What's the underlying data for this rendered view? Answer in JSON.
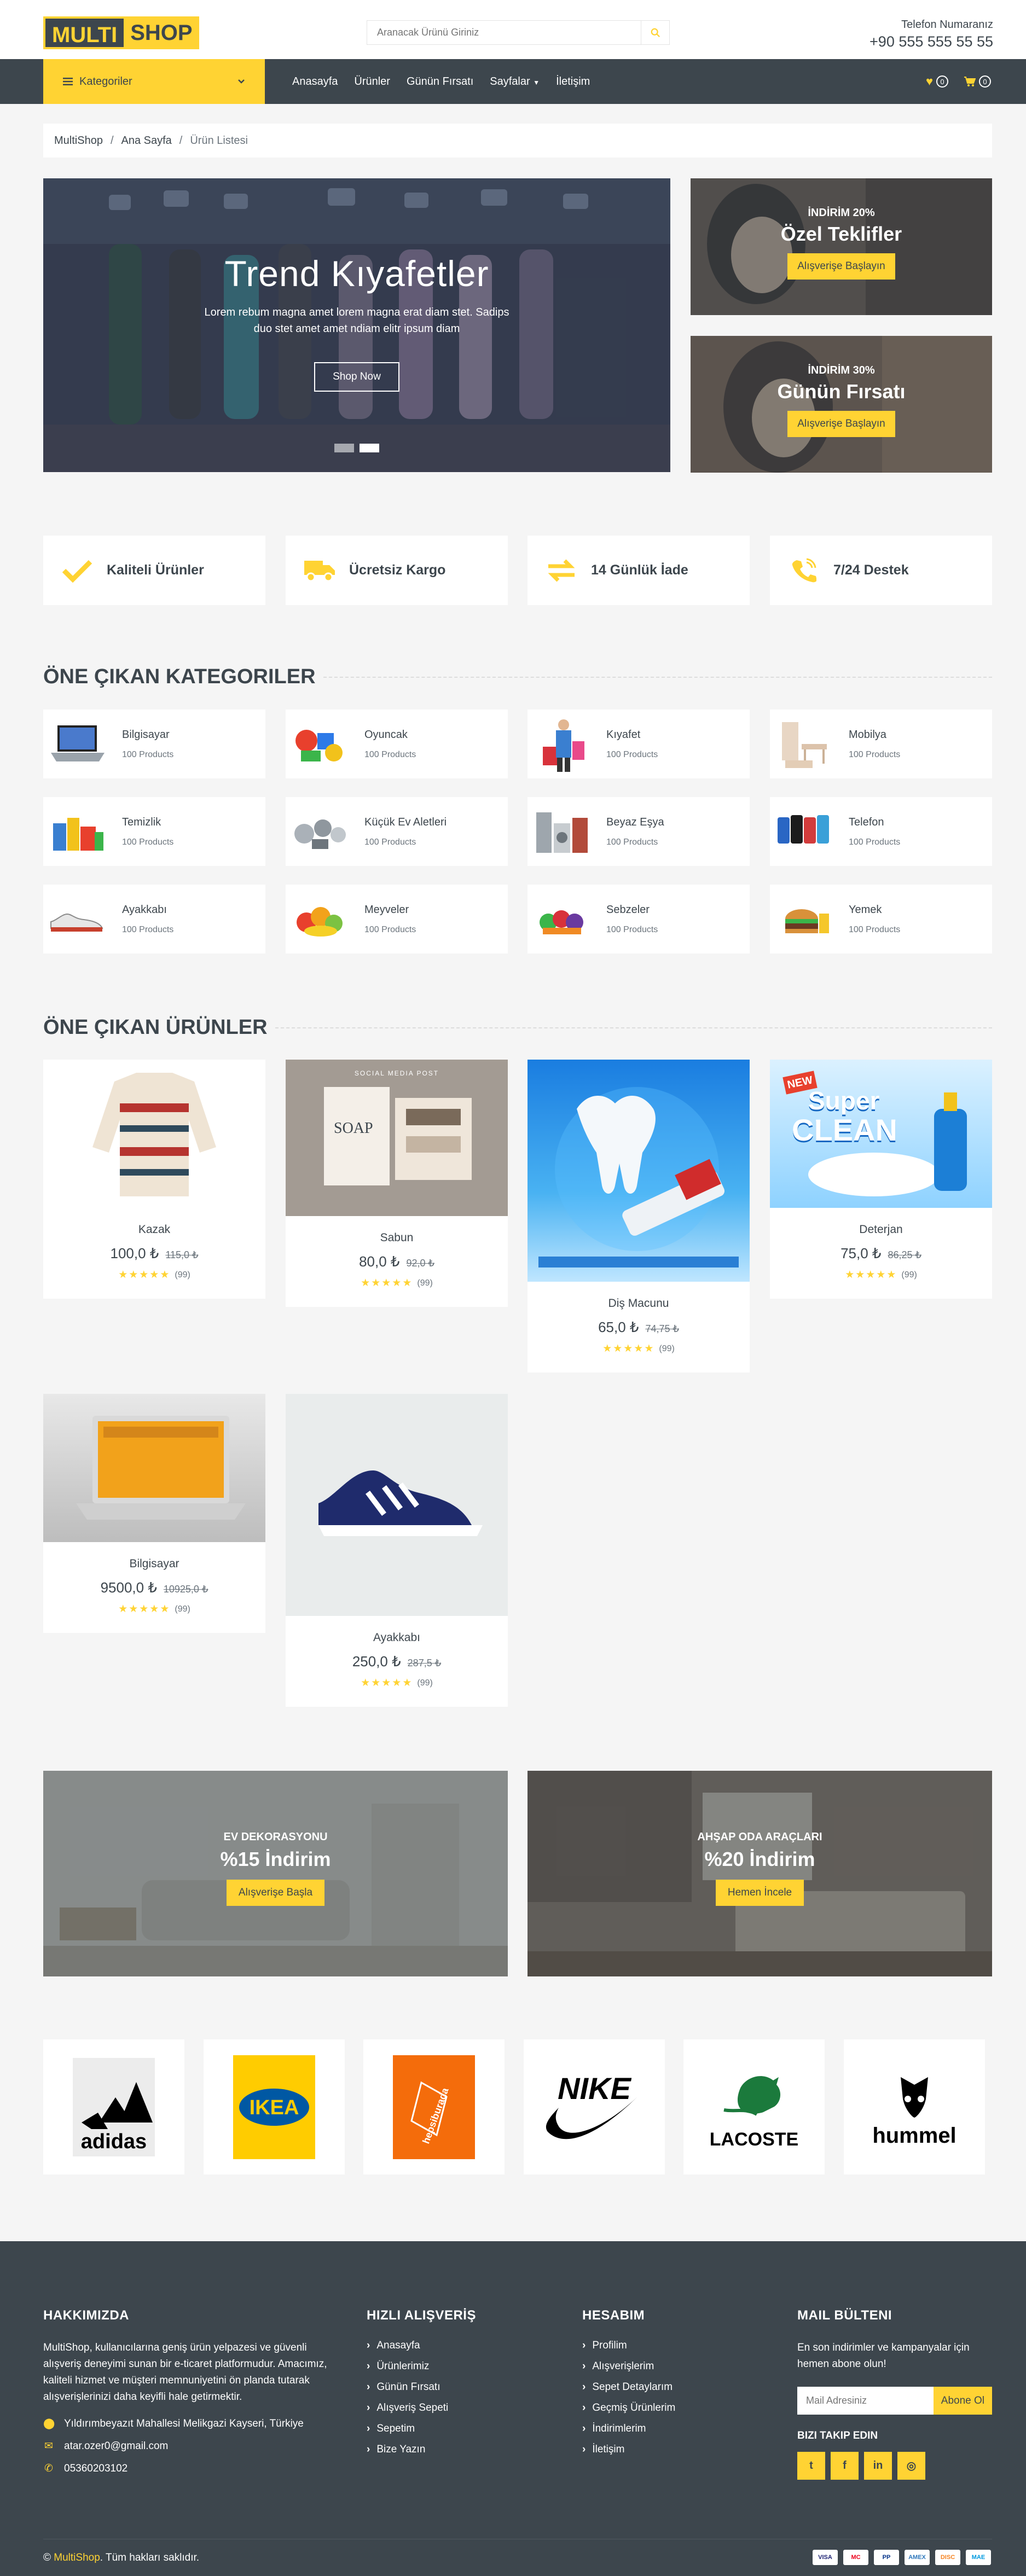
{
  "header": {
    "logo_part1": "MULTI",
    "logo_part2": "SHOP",
    "search_placeholder": "Aranacak Ürünü Giriniz",
    "phone_label": "Telefon Numaranız",
    "phone_number": "+90 555 555 55 55"
  },
  "navbar": {
    "categories_label": "Kategoriler",
    "links": [
      "Anasayfa",
      "Ürünler",
      "Günün Fırsatı",
      "Sayfalar",
      "İletişim"
    ],
    "wishlist_count": "0",
    "cart_count": "0"
  },
  "breadcrumb": [
    "MultiShop",
    "Ana Sayfa",
    "Ürün Listesi"
  ],
  "hero": {
    "title": "Trend Kıyafetler",
    "text": "Lorem rebum magna amet lorem magna erat diam stet. Sadips duo stet amet amet ndiam elitr ipsum diam",
    "button": "Shop Now"
  },
  "offers": [
    {
      "tag": "İNDİRİM 20%",
      "title": "Özel Teklifler",
      "button": "Alışverişe Başlayın"
    },
    {
      "tag": "İNDİRİM 30%",
      "title": "Günün Fırsatı",
      "button": "Alışverişe Başlayın"
    }
  ],
  "features": [
    "Kaliteli Ürünler",
    "Ücretsiz Kargo",
    "14 Günlük İade",
    "7/24 Destek"
  ],
  "categories_title": "ÖNE ÇIKAN KATEGORILER",
  "categories": [
    {
      "name": "Bilgisayar",
      "count": "100 Products"
    },
    {
      "name": "Oyuncak",
      "count": "100 Products"
    },
    {
      "name": "Kıyafet",
      "count": "100 Products"
    },
    {
      "name": "Mobilya",
      "count": "100 Products"
    },
    {
      "name": "Temizlik",
      "count": "100 Products"
    },
    {
      "name": "Küçük Ev Aletleri",
      "count": "100 Products"
    },
    {
      "name": "Beyaz Eşya",
      "count": "100 Products"
    },
    {
      "name": "Telefon",
      "count": "100 Products"
    },
    {
      "name": "Ayakkabı",
      "count": "100 Products"
    },
    {
      "name": "Meyveler",
      "count": "100 Products"
    },
    {
      "name": "Sebzeler",
      "count": "100 Products"
    },
    {
      "name": "Yemek",
      "count": "100 Products"
    }
  ],
  "products_title": "ÖNE ÇIKAN ÜRÜNLER",
  "products": [
    {
      "name": "Kazak",
      "price": "100,0 ₺",
      "old_price": "115,0 ₺",
      "reviews": "(99)"
    },
    {
      "name": "Sabun",
      "price": "80,0 ₺",
      "old_price": "92,0 ₺",
      "reviews": "(99)",
      "image_title": "SOCIAL MEDIA POST",
      "image_brand": "SOAP"
    },
    {
      "name": "Diş Macunu",
      "price": "65,0 ₺",
      "old_price": "74,75 ₺",
      "reviews": "(99)"
    },
    {
      "name": "Deterjan",
      "price": "75,0 ₺",
      "old_price": "86,25 ₺",
      "reviews": "(99)",
      "image_new": "NEW",
      "image_brand1": "Super",
      "image_brand2": "CLEAN"
    },
    {
      "name": "Bilgisayar",
      "price": "9500,0 ₺",
      "old_price": "10925,0 ₺",
      "reviews": "(99)"
    },
    {
      "name": "Ayakkabı",
      "price": "250,0 ₺",
      "old_price": "287,5 ₺",
      "reviews": "(99)"
    }
  ],
  "promos": [
    {
      "tag": "EV DEKORASYONU",
      "title": "%15 İndirim",
      "button": "Alışverişe Başla"
    },
    {
      "tag": "AHŞAP ODA ARAÇLARI",
      "title": "%20 İndirim",
      "button": "Hemen İncele"
    }
  ],
  "brands": [
    "adidas",
    "IKEA",
    "hepsiburada",
    "NIKE",
    "LACOSTE",
    "hummel"
  ],
  "footer": {
    "about_title": "HAKKIMIZDA",
    "about_text": "MultiShop, kullanıcılarına geniş ürün yelpazesi ve güvenli alışveriş deneyimi sunan bir e-ticaret platformudur. Amacımız, kaliteli hizmet ve müşteri memnuniyetini ön planda tutarak alışverişlerinizi daha keyifli hale getirmektir.",
    "address": "Yıldırımbeyazıt Mahallesi Melikgazi Kayseri, Türkiye",
    "email": "atar.ozer0@gmail.com",
    "phone": "05360203102",
    "quick_title": "HIZLI ALIŞVERİŞ",
    "quick_links": [
      "Anasayfa",
      "Ürünlerimiz",
      "Günün Fırsatı",
      "Alışveriş Sepeti",
      "Sepetim",
      "Bize Yazın"
    ],
    "account_title": "HESABIM",
    "account_links": [
      "Profilim",
      "Alışverişlerim",
      "Sepet Detaylarım",
      "Geçmiş Ürünlerim",
      "İndirimlerim",
      "İletişim"
    ],
    "newsletter_title": "MAIL BÜLTENI",
    "newsletter_text": "En son indirimler ve kampanyalar için hemen abone olun!",
    "newsletter_placeholder": "Mail Adresiniz",
    "newsletter_button": "Abone Ol",
    "follow_title": "BIZI TAKIP EDIN",
    "copyright_brand": "MultiShop",
    "copyright_text": ". Tüm hakları saklıdır.",
    "copyright_symbol": "©",
    "payments": [
      "VISA",
      "MC",
      "PP",
      "AMEX",
      "DISC",
      "MAE"
    ]
  },
  "colors": {
    "accent": "#ffd333",
    "dark": "#3d464d",
    "background": "#f5f5f5"
  }
}
